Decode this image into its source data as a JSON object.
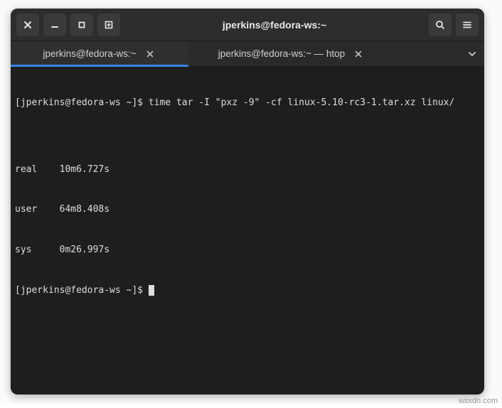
{
  "window": {
    "title": "jperkins@fedora-ws:~"
  },
  "tabs": [
    {
      "label": "jperkins@fedora-ws:~",
      "active": true
    },
    {
      "label": "jperkins@fedora-ws:~ — htop",
      "active": false
    }
  ],
  "terminal": {
    "lines": [
      "[jperkins@fedora-ws ~]$ time tar -I \"pxz -9\" -cf linux-5.10-rc3-1.tar.xz linux/",
      "",
      "real    10m6.727s",
      "user    64m8.408s",
      "sys     0m26.997s",
      "[jperkins@fedora-ws ~]$ "
    ]
  },
  "watermark": "wsxdn.com"
}
